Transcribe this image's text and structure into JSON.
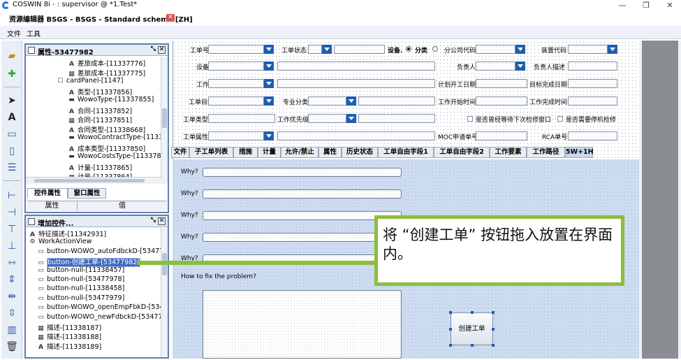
{
  "window": {
    "app_title": "COSWIN 8i - : supervisor @ *1.Test*",
    "sub_title": "资源编辑器 BSGS - BSGS - Standard schema [ZH]",
    "close_glyph": "✕"
  },
  "menu": {
    "file": "文件",
    "tools": "工具"
  },
  "properties_panel": {
    "title": "属性-53477982",
    "tree": [
      {
        "icon": "A",
        "label": "差旅成本-[11337776]"
      },
      {
        "icon": "▦",
        "label": "差旅成本-[11337775]"
      },
      {
        "icon": "☐",
        "label": "cardPanel-[1147]"
      },
      {
        "icon": "A",
        "label": "类型-[11337856]"
      },
      {
        "icon": "▬",
        "label": "WowoType-[11337855]"
      },
      {
        "icon": "A",
        "label": "合同-[11337852]"
      },
      {
        "icon": "▦",
        "label": "合同-[11337851]"
      },
      {
        "icon": "A",
        "label": "合同类型-[11338668]"
      },
      {
        "icon": "▬",
        "label": "WowoContractType-[1133866"
      },
      {
        "icon": "A",
        "label": "成本类型-[11337850]"
      },
      {
        "icon": "▬",
        "label": "WowoCostsType-[11337849]"
      },
      {
        "icon": "A",
        "label": "计量-[11337865]"
      },
      {
        "icon": "▦",
        "label": "计量-[11337864]"
      }
    ],
    "tabs": [
      "控件属性",
      "窗口属性"
    ],
    "table_headers": [
      "属性",
      "值"
    ]
  },
  "add_controls_panel": {
    "title": "增加控件...",
    "tree": [
      {
        "icon": "A",
        "label": "特征描述-[11342931]",
        "selected": false
      },
      {
        "icon": "⚙",
        "label": "WorkActionView",
        "selected": false
      },
      {
        "icon": "▭",
        "label": "button-WOWO_autoFdbckD-[53477980",
        "selected": false
      },
      {
        "icon": "▭",
        "label": "button-创建工单-[53477982]",
        "selected": true
      },
      {
        "icon": "▭",
        "label": "button-null-[11338457]",
        "selected": false
      },
      {
        "icon": "▭",
        "label": "button-null-[53477978]",
        "selected": false
      },
      {
        "icon": "▭",
        "label": "button-null-[11338458]",
        "selected": false
      },
      {
        "icon": "▭",
        "label": "button-null-[53477979]",
        "selected": false
      },
      {
        "icon": "▭",
        "label": "button-WOWO_openEmpFbkD-[534778",
        "selected": false
      },
      {
        "icon": "▭",
        "label": "button-WOWO_newFdbckD-[53477981",
        "selected": false
      },
      {
        "icon": "▦",
        "label": "描述-[11338187]",
        "selected": false
      },
      {
        "icon": "▦",
        "label": "描述-[11338188]",
        "selected": false
      },
      {
        "icon": "A",
        "label": "描述-[11338189]",
        "selected": false
      }
    ]
  },
  "form": {
    "labels": {
      "work_order_no": "工单号",
      "work_order_status": "工单状态",
      "equipment_radio": "设备.",
      "category_radio": "分类",
      "branch_code": "分公司代码",
      "unit_code": "装置代码",
      "equipment": "设备",
      "owner": "负责人",
      "owner_desc": "负责人描述",
      "work": "工作",
      "plan_start": "计划开工日期",
      "target_finish": "目标完成日期",
      "wo_purpose": "工单目的",
      "specialty": "专业分类",
      "work_start_time": "工作开始时间",
      "work_finish_time": "工作完成时间",
      "wo_type": "工单类型",
      "work_priority": "工作优先级",
      "wait_next_window": "是否曾经等待下次检修窗口",
      "need_shutdown": "是否需要停机检修",
      "wo_attribute": "工单属性",
      "moc_no": "MOC申请单号",
      "rca_no": "RCA单号"
    },
    "tabs": [
      "文件",
      "子工单列表",
      "措施",
      "计量",
      "允许/禁止",
      "属性",
      "历史状态",
      "工单自由字段1",
      "工单自由字段2",
      "工作要素",
      "工作路径",
      "5W+1H"
    ],
    "active_tab": "5W+1H",
    "why_label": "Why?",
    "fix_label": "How to fix the problem?",
    "create_button": "创建工单"
  },
  "callout": {
    "text": "将 “创建工单” 按钮拖入放置在界面内。"
  },
  "colors": {
    "accent": "#1c5fb3",
    "callout_border": "#8cbe3b"
  }
}
